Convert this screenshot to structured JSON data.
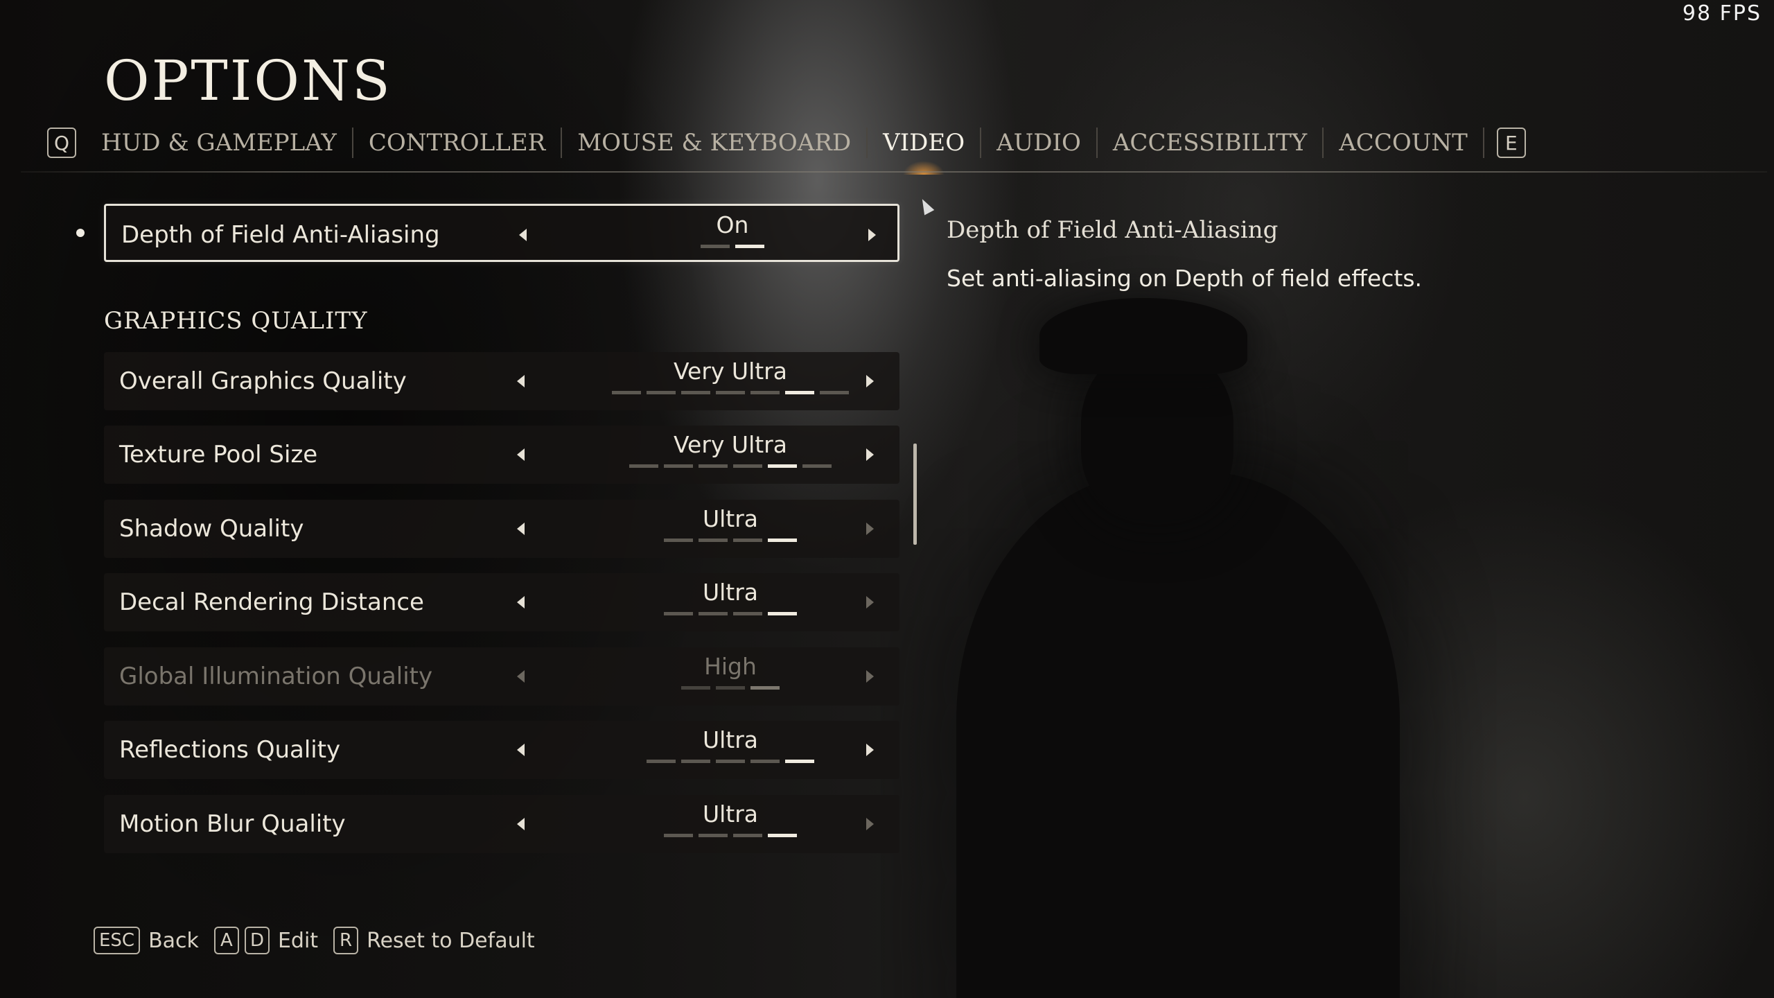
{
  "fps": "98  FPS",
  "title": "OPTIONS",
  "tabs": {
    "prev_key": "Q",
    "next_key": "E",
    "items": [
      {
        "label": "HUD & GAMEPLAY"
      },
      {
        "label": "CONTROLLER"
      },
      {
        "label": "MOUSE & KEYBOARD"
      },
      {
        "label": "VIDEO",
        "active": true
      },
      {
        "label": "AUDIO"
      },
      {
        "label": "ACCESSIBILITY"
      },
      {
        "label": "ACCOUNT"
      }
    ]
  },
  "settings": {
    "dof_aa": {
      "label": "Depth of Field Anti-Aliasing",
      "value": "On",
      "level": 2,
      "steps": 2
    },
    "section_title": "GRAPHICS QUALITY",
    "rows": [
      {
        "label": "Overall Graphics Quality",
        "value": "Very Ultra",
        "level": 6,
        "steps": 7
      },
      {
        "label": "Texture Pool Size",
        "value": "Very Ultra",
        "level": 5,
        "steps": 6
      },
      {
        "label": "Shadow Quality",
        "value": "Ultra",
        "level": 4,
        "steps": 4
      },
      {
        "label": "Decal Rendering Distance",
        "value": "Ultra",
        "level": 4,
        "steps": 4
      },
      {
        "label": "Global Illumination Quality",
        "value": "High",
        "level": 3,
        "steps": 3,
        "disabled": true
      },
      {
        "label": "Reflections Quality",
        "value": "Ultra",
        "level": 5,
        "steps": 5
      },
      {
        "label": "Motion Blur Quality",
        "value": "Ultra",
        "level": 4,
        "steps": 4
      }
    ]
  },
  "description": {
    "title": "Depth of Field Anti-Aliasing",
    "body": "Set anti-aliasing on Depth of field effects."
  },
  "footer": {
    "back_key": "ESC",
    "back_label": "Back",
    "edit_key_a": "A",
    "edit_key_d": "D",
    "edit_label": "Edit",
    "reset_key": "R",
    "reset_label": "Reset to Default"
  }
}
